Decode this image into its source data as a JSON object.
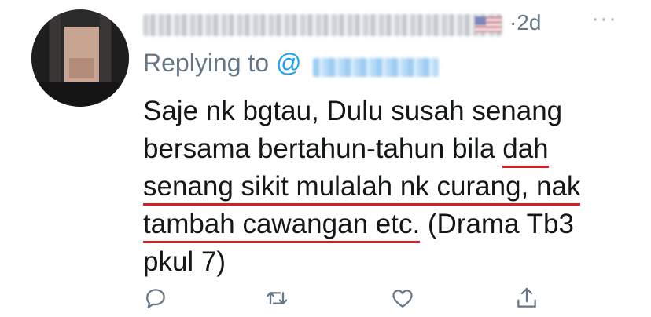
{
  "tweet": {
    "time": "2d",
    "more": "···",
    "replying_prefix": "Replying to",
    "at_symbol": "@",
    "lines": [
      {
        "a": "Saje nk bgtau, Dulu susah senang",
        "b": ""
      },
      {
        "a": "bersama bertahun-tahun bila ",
        "b": "dah"
      },
      {
        "a": "",
        "b": "senang sikit mulalah nk curang, nak"
      },
      {
        "a": "tambah cawangan etc.",
        "b": " (Drama Tb3"
      },
      {
        "a": "pkul 7)",
        "b": ""
      }
    ]
  },
  "icons": {
    "reply": "reply-icon",
    "retweet": "retweet-icon",
    "like": "heart-icon",
    "share": "share-icon"
  },
  "colors": {
    "muted": "#657786",
    "link": "#1da1f2",
    "underline": "#d21f2a"
  }
}
